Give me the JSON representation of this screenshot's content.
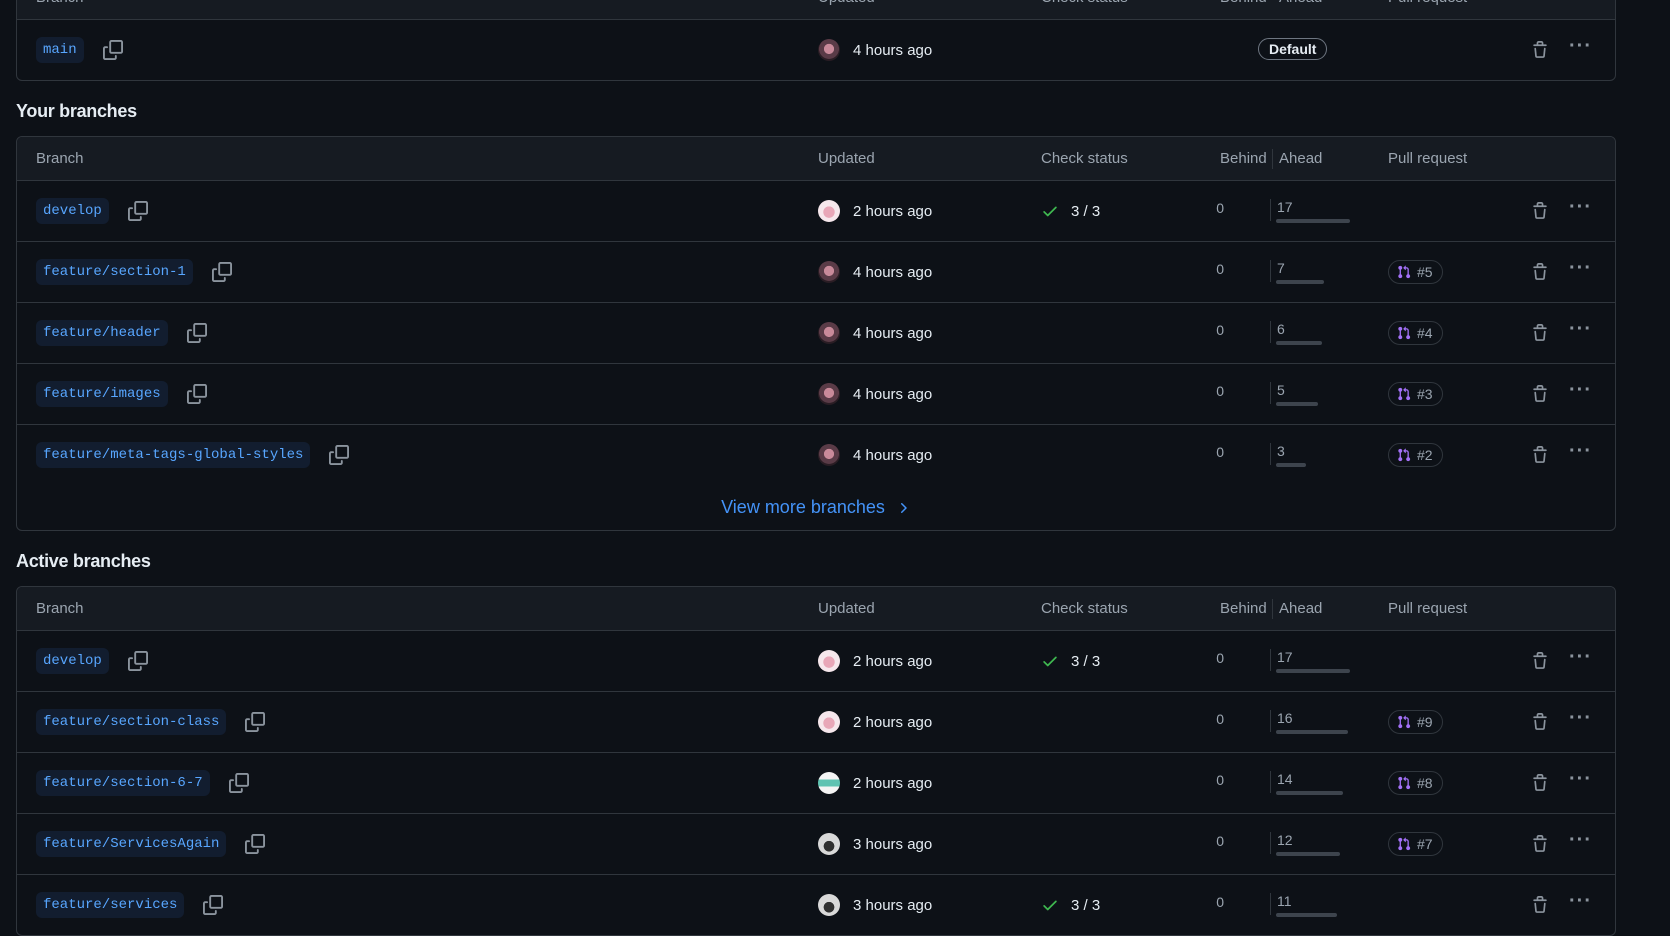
{
  "headers": {
    "branch": "Branch",
    "updated": "Updated",
    "check_status": "Check status",
    "behind": "Behind",
    "ahead": "Ahead",
    "pull_request": "Pull request"
  },
  "default_section": {
    "rows": [
      {
        "branch": "main",
        "updated": "4 hours ago",
        "avatar": "dark",
        "badge": "Default"
      }
    ]
  },
  "your_branches": {
    "title": "Your branches",
    "rows": [
      {
        "branch": "develop",
        "updated": "2 hours ago",
        "avatar": "pink",
        "check": "3 / 3",
        "behind": "0",
        "ahead": "17",
        "ahead_ratio": 1.0,
        "pr": ""
      },
      {
        "branch": "feature/section-1",
        "updated": "4 hours ago",
        "avatar": "dark",
        "check": "",
        "behind": "0",
        "ahead": "7",
        "ahead_ratio": 0.65,
        "pr": "#5"
      },
      {
        "branch": "feature/header",
        "updated": "4 hours ago",
        "avatar": "dark",
        "check": "",
        "behind": "0",
        "ahead": "6",
        "ahead_ratio": 0.62,
        "pr": "#4"
      },
      {
        "branch": "feature/images",
        "updated": "4 hours ago",
        "avatar": "dark",
        "check": "",
        "behind": "0",
        "ahead": "5",
        "ahead_ratio": 0.57,
        "pr": "#3"
      },
      {
        "branch": "feature/meta-tags-global-styles",
        "updated": "4 hours ago",
        "avatar": "dark",
        "check": "",
        "behind": "0",
        "ahead": "3",
        "ahead_ratio": 0.4,
        "pr": "#2"
      }
    ],
    "view_more": "View more branches"
  },
  "active_branches": {
    "title": "Active branches",
    "rows": [
      {
        "branch": "develop",
        "updated": "2 hours ago",
        "avatar": "pink",
        "check": "3 / 3",
        "behind": "0",
        "ahead": "17",
        "ahead_ratio": 1.0,
        "pr": ""
      },
      {
        "branch": "feature/section-class",
        "updated": "2 hours ago",
        "avatar": "pink",
        "check": "",
        "behind": "0",
        "ahead": "16",
        "ahead_ratio": 0.97,
        "pr": "#9"
      },
      {
        "branch": "feature/section-6-7",
        "updated": "2 hours ago",
        "avatar": "teal",
        "check": "",
        "behind": "0",
        "ahead": "14",
        "ahead_ratio": 0.91,
        "pr": "#8"
      },
      {
        "branch": "feature/ServicesAgain",
        "updated": "3 hours ago",
        "avatar": "gray",
        "check": "",
        "behind": "0",
        "ahead": "12",
        "ahead_ratio": 0.86,
        "pr": "#7"
      },
      {
        "branch": "feature/services",
        "updated": "3 hours ago",
        "avatar": "gray",
        "check": "3 / 3",
        "behind": "0",
        "ahead": "11",
        "ahead_ratio": 0.82,
        "pr": ""
      }
    ]
  },
  "colors": {
    "background": "#0d1117",
    "header_bg": "#161b22",
    "border": "#30363d",
    "link": "#4493f8",
    "branch_text": "#58a6ff",
    "success": "#3fb950",
    "pr_icon": "#a371f7"
  },
  "icons": {
    "copy": "copy-icon",
    "trash": "trash-icon",
    "more": "kebab-horizontal-icon",
    "check": "check-icon",
    "pr": "git-pull-request-icon",
    "chevron": "chevron-right-icon"
  }
}
